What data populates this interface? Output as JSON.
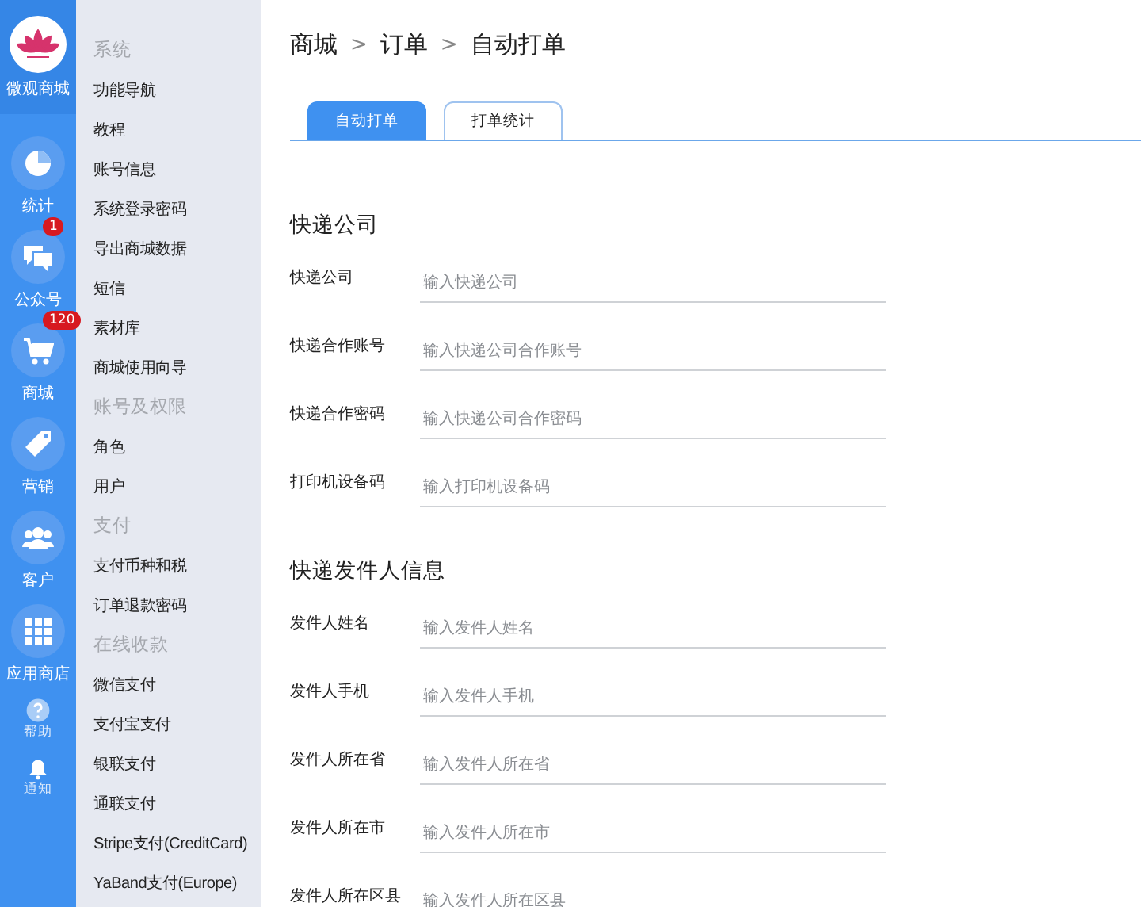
{
  "rail": {
    "brand": "微观商城",
    "items": [
      {
        "kind": "pie",
        "label": "统计"
      },
      {
        "kind": "chat",
        "label": "公众号",
        "badge": "1"
      },
      {
        "kind": "cart",
        "label": "商城",
        "badge": "120"
      },
      {
        "kind": "tag",
        "label": "营销"
      },
      {
        "kind": "people",
        "label": "客户"
      },
      {
        "kind": "grid",
        "label": "应用商店"
      }
    ],
    "small_items": [
      {
        "kind": "help",
        "label": "帮助"
      },
      {
        "kind": "bell",
        "label": "通知"
      }
    ]
  },
  "menu": [
    {
      "kind": "header",
      "label": "系统"
    },
    {
      "kind": "item",
      "label": "功能导航"
    },
    {
      "kind": "item",
      "label": "教程"
    },
    {
      "kind": "item",
      "label": "账号信息"
    },
    {
      "kind": "item",
      "label": "系统登录密码"
    },
    {
      "kind": "item",
      "label": "导出商城数据"
    },
    {
      "kind": "item",
      "label": "短信"
    },
    {
      "kind": "item",
      "label": "素材库"
    },
    {
      "kind": "item",
      "label": "商城使用向导"
    },
    {
      "kind": "header",
      "label": "账号及权限"
    },
    {
      "kind": "item",
      "label": "角色"
    },
    {
      "kind": "item",
      "label": "用户"
    },
    {
      "kind": "header",
      "label": "支付"
    },
    {
      "kind": "item",
      "label": "支付币种和税"
    },
    {
      "kind": "item",
      "label": "订单退款密码"
    },
    {
      "kind": "header",
      "label": "在线收款"
    },
    {
      "kind": "item",
      "label": "微信支付"
    },
    {
      "kind": "item",
      "label": "支付宝支付"
    },
    {
      "kind": "item",
      "label": "银联支付"
    },
    {
      "kind": "item",
      "label": "通联支付"
    },
    {
      "kind": "item",
      "label": "Stripe支付(CreditCard)"
    },
    {
      "kind": "item",
      "label": "YaBand支付(Europe)"
    }
  ],
  "breadcrumb": [
    "商城",
    "订单",
    "自动打单"
  ],
  "separator": ">",
  "tabs": [
    {
      "label": "自动打单",
      "selected": true
    },
    {
      "label": "打单统计",
      "selected": false
    }
  ],
  "sections": [
    {
      "title": "快递公司",
      "fields": [
        {
          "label": "快递公司",
          "placeholder": "输入快递公司"
        },
        {
          "label": "快递合作账号",
          "placeholder": "输入快递公司合作账号"
        },
        {
          "label": "快递合作密码",
          "placeholder": "输入快递公司合作密码"
        },
        {
          "label": "打印机设备码",
          "placeholder": "输入打印机设备码"
        }
      ]
    },
    {
      "title": "快递发件人信息",
      "fields": [
        {
          "label": "发件人姓名",
          "placeholder": "输入发件人姓名"
        },
        {
          "label": "发件人手机",
          "placeholder": "输入发件人手机"
        },
        {
          "label": "发件人所在省",
          "placeholder": "输入发件人所在省"
        },
        {
          "label": "发件人所在市",
          "placeholder": "输入发件人所在市"
        },
        {
          "label": "发件人所在区县",
          "placeholder": "输入发件人所在区县"
        }
      ]
    }
  ]
}
